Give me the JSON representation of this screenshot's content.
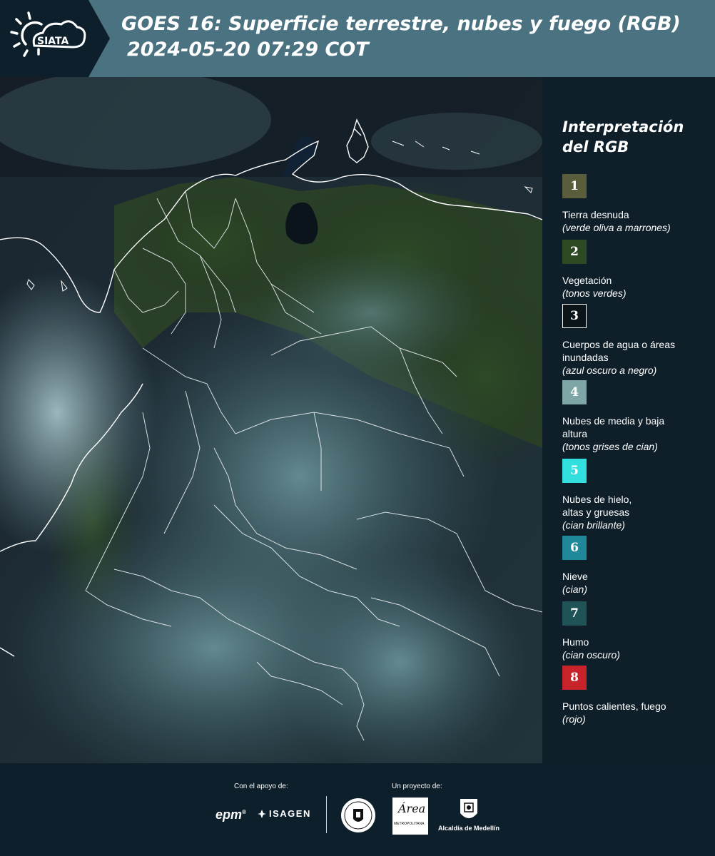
{
  "header": {
    "logo_text": "SIATA",
    "title_line1": "GOES 16: Superficie terrestre, nubes y fuego (RGB)",
    "title_line2": "2024-05-20 07:29 COT",
    "band_color": "#4a7280"
  },
  "map": {
    "icons": [
      "satellite-rgb-image",
      "country-border",
      "department-border"
    ]
  },
  "legend": {
    "title": "Interpretación del RGB",
    "items": [
      {
        "number": "1",
        "label": "Tierra desnuda",
        "desc": "(verde oliva a marrones)",
        "color": "#5a5d3c"
      },
      {
        "number": "2",
        "label": "Vegetación",
        "desc": "(tonos verdes)",
        "color": "#2e4a22"
      },
      {
        "number": "3",
        "label": "Cuerpos de agua o áreas inundadas",
        "desc": "(azul oscuro a negro)",
        "color": "#0b1418"
      },
      {
        "number": "4",
        "label": "Nubes de media y baja altura",
        "desc": "(tonos grises de cian)",
        "color": "#7fa6a6"
      },
      {
        "number": "5",
        "label": "Nubes de hielo, altas y gruesas",
        "desc": "(cian brillante)",
        "color": "#33dede"
      },
      {
        "number": "6",
        "label": "Nieve",
        "desc": "(cian)",
        "color": "#21889a"
      },
      {
        "number": "7",
        "label": "Humo",
        "desc": "(cian oscuro)",
        "color": "#1f5356"
      },
      {
        "number": "8",
        "label": "Puntos calientes, fuego",
        "desc": "(rojo)",
        "color": "#c8232a"
      }
    ]
  },
  "footer": {
    "support_label": "Con el apoyo de:",
    "project_label": "Un proyecto de:",
    "epm_logo": "epm",
    "isagen_logo": "ISAGEN",
    "area_logo": "Área",
    "area_sub": "METROPOLITANA",
    "medellin_text": "Alcaldía de Medellín"
  }
}
